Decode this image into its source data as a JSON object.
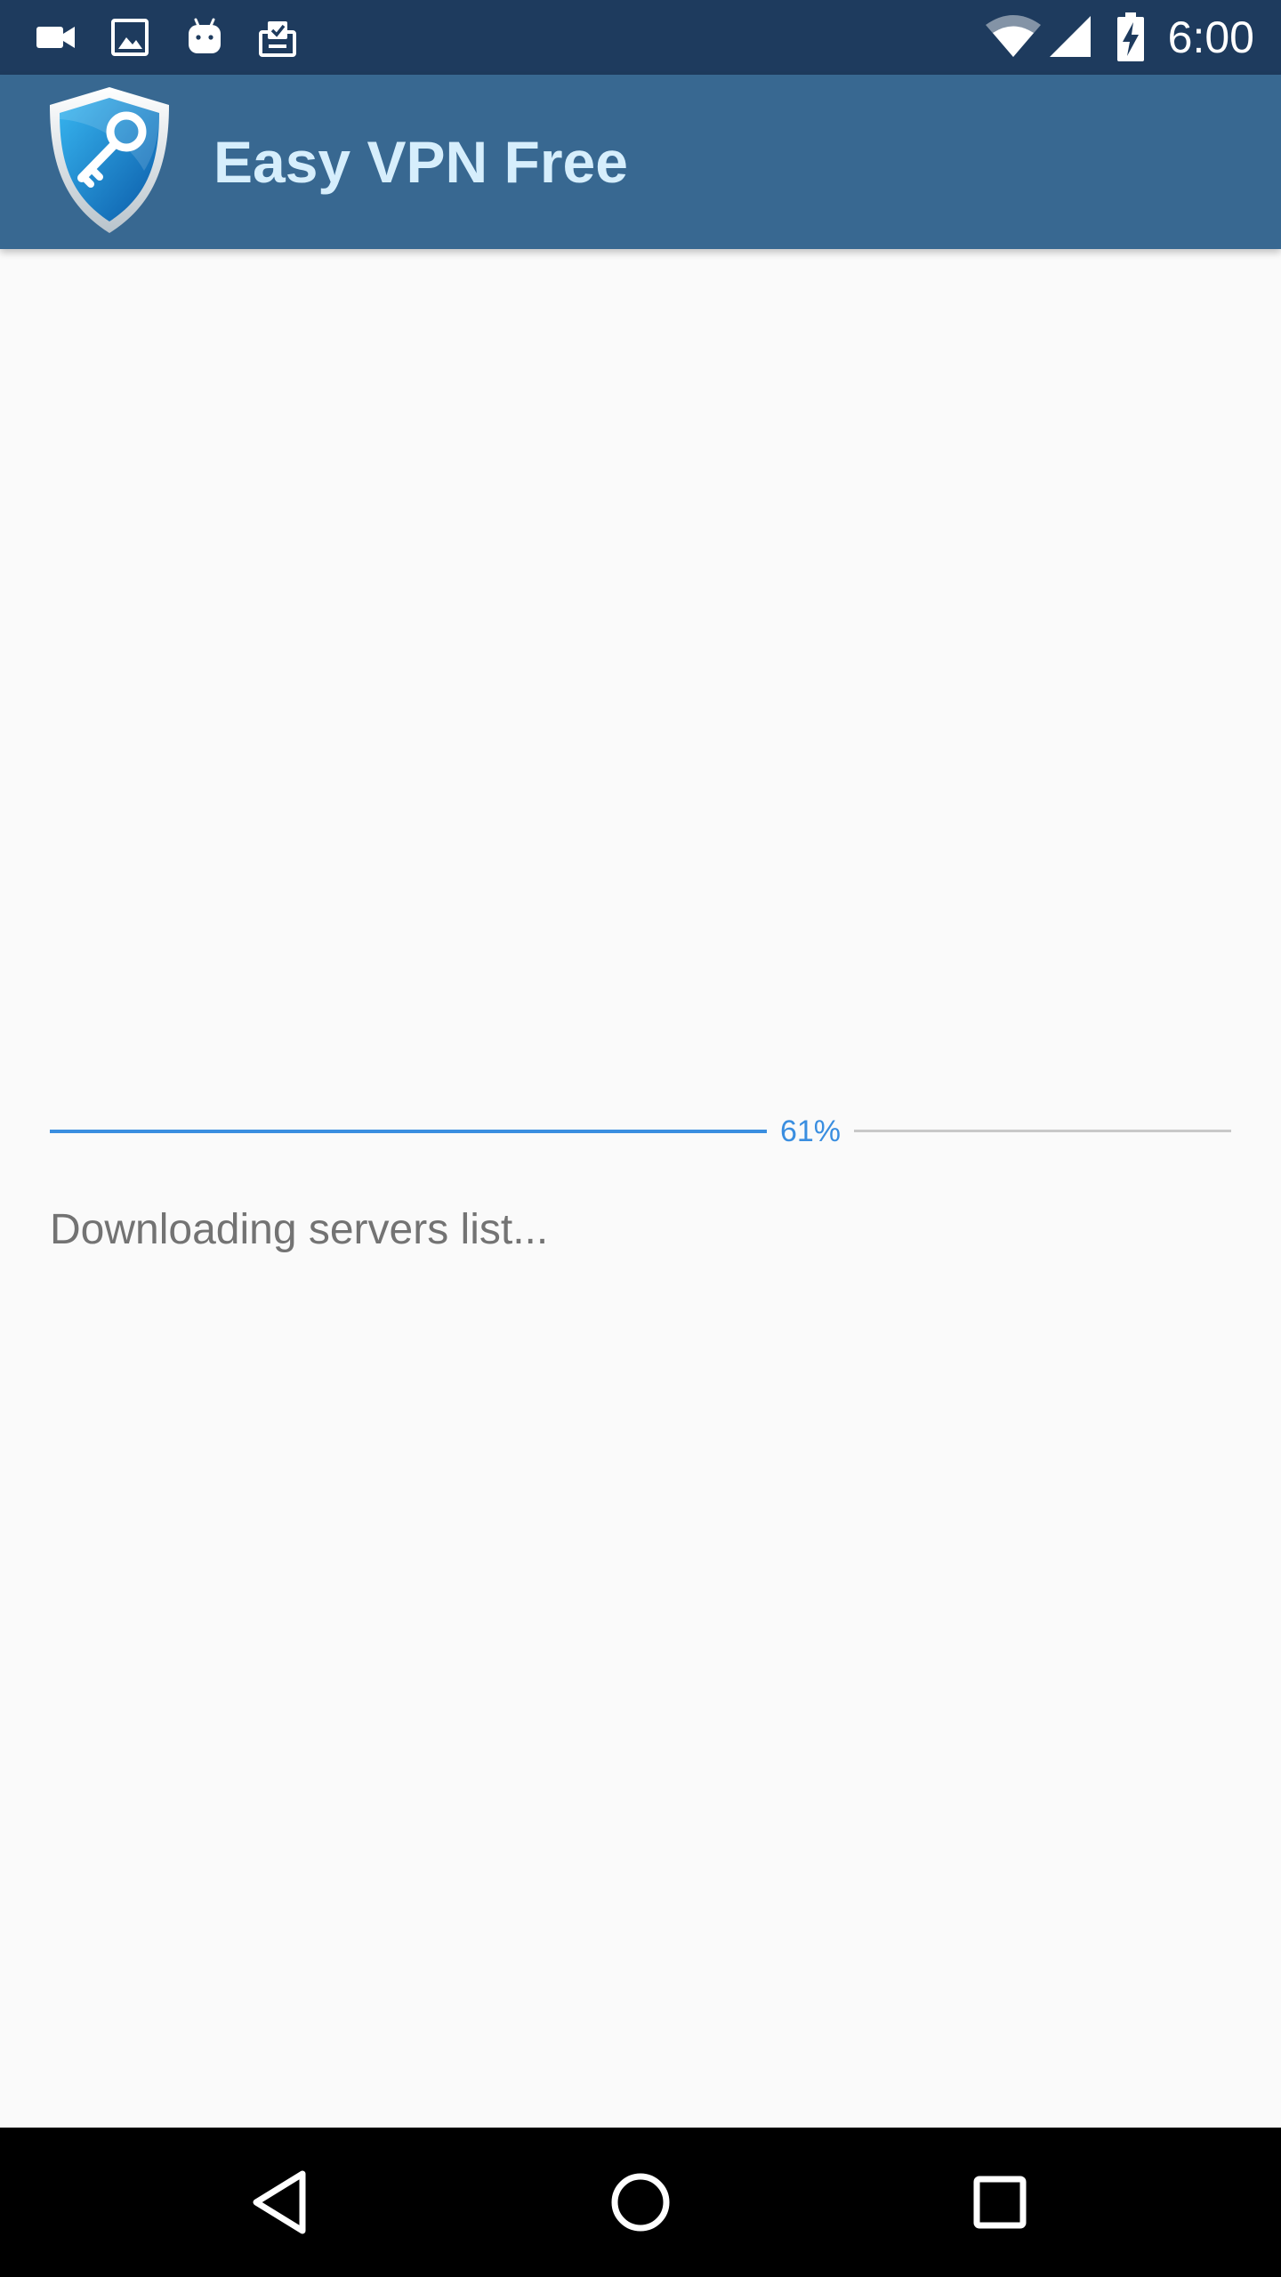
{
  "status_bar": {
    "time": "6:00",
    "left_icons": [
      "video-camera-icon",
      "image-icon",
      "android-icon",
      "clipboard-check-icon"
    ],
    "right_icons": [
      "wifi-icon",
      "signal-icon",
      "battery-charging-icon"
    ]
  },
  "app_bar": {
    "title": "Easy VPN Free",
    "logo": "shield-key-icon"
  },
  "progress": {
    "percent": 61,
    "label": "61%",
    "status_text": "Downloading servers list..."
  },
  "nav_bar": {
    "buttons": [
      "back-icon",
      "home-icon",
      "recents-icon"
    ]
  },
  "colors": {
    "status_bar": "#1e3b5e",
    "app_bar": "#386891",
    "title": "#d6eefc",
    "accent": "#3a8ee0",
    "track": "#c8c8c8",
    "background": "#fafafa",
    "status_text": "#737373",
    "nav_bar": "#000000"
  }
}
